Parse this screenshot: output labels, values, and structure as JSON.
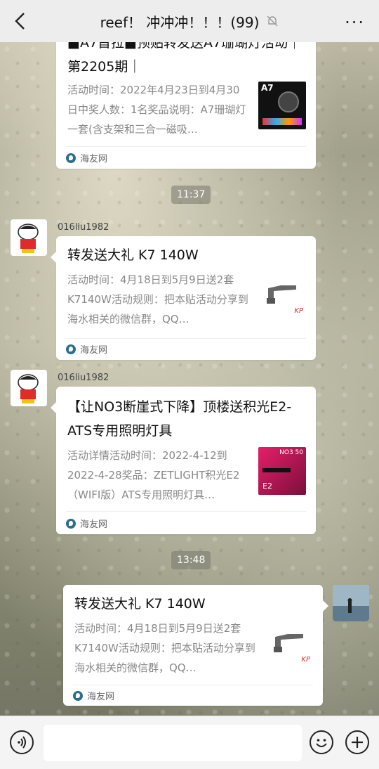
{
  "header": {
    "title": "reef！ 冲冲冲！！！(99)",
    "back_icon": "back-chevron-icon",
    "mute_icon": "bell-muted-icon",
    "more_label": "···"
  },
  "messages": [
    {
      "title": "■A7首拉■预贴转发送A7珊瑚灯活动｜第2205期｜",
      "desc": "活动时间：2022年4月23日到4月30日中奖人数：1名奖品说明：A7珊瑚灯一套(含支架和三合一磁吸…",
      "source": "海友网",
      "thumb_label": "A7"
    },
    {
      "time": "11:37"
    },
    {
      "sender": "016liu1982",
      "title": "转发送大礼 K7 140W",
      "desc": "活动时间：4月18日到5月9日送2套K7140W活动规则：把本贴活动分享到海水相关的微信群，QQ…",
      "source": "海友网",
      "thumb_label": "KP"
    },
    {
      "sender": "016liu1982",
      "title": "【让NO3断崖式下降】顶楼送积光E2-ATS专用照明灯具",
      "desc": "活动详情活动时间：2022-4-12到2022-4-28奖品：ZETLIGHT积光E2（WIFI版）ATS专用照明灯具…",
      "source": "海友网",
      "thumb_label": "NO3 50"
    },
    {
      "time": "13:48"
    },
    {
      "title": "转发送大礼 K7 140W",
      "desc": "活动时间：4月18日到5月9日送2套K7140W活动规则：把本贴活动分享到海水相关的微信群，QQ…",
      "source": "海友网",
      "thumb_label": "KP"
    }
  ],
  "bottom": {
    "voice_icon": "voice-icon",
    "input_value": "",
    "emoji_icon": "emoji-icon",
    "plus_icon": "plus-icon"
  },
  "colors": {
    "bar_bg": "#ededed",
    "card_bg": "#ffffff",
    "desc_text": "#888888"
  }
}
